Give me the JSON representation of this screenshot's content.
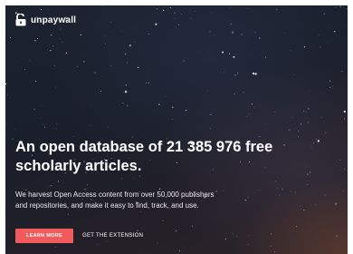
{
  "brand": {
    "logo_icon": "unlocked-padlock-icon",
    "name": "unpaywall"
  },
  "hero": {
    "headline_line1": "An open database of 21 385 976 free",
    "headline_line2": "scholarly articles.",
    "subtext_line1": "We harvest Open Access content from over 50,000 publishers",
    "subtext_line2": "and repositories, and make it easy to find, track, and use."
  },
  "actions": {
    "primary_label": "LEARN MORE",
    "secondary_label": "GET THE EXTENSION"
  },
  "colors": {
    "accent": "#f05a5a",
    "background": "#1c2230",
    "text": "#ffffff"
  }
}
